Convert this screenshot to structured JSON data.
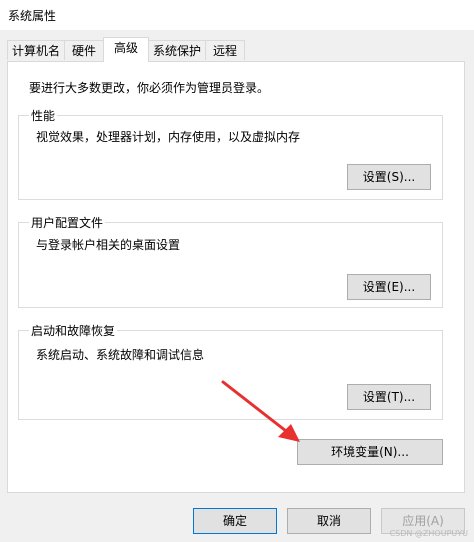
{
  "window": {
    "title": "系统属性"
  },
  "tabs": [
    {
      "label": "计算机名"
    },
    {
      "label": "硬件"
    },
    {
      "label": "高级"
    },
    {
      "label": "系统保护"
    },
    {
      "label": "远程"
    }
  ],
  "notice": "要进行大多数更改，你必须作为管理员登录。",
  "performance": {
    "title": "性能",
    "description": "视觉效果，处理器计划，内存使用，以及虚拟内存",
    "button": "设置(S)..."
  },
  "user_profiles": {
    "title": "用户配置文件",
    "description": "与登录帐户相关的桌面设置",
    "button": "设置(E)..."
  },
  "startup_recovery": {
    "title": "启动和故障恢复",
    "description": "系统启动、系统故障和调试信息",
    "button": "设置(T)..."
  },
  "env_button": "环境变量(N)...",
  "footer": {
    "ok": "确定",
    "cancel": "取消",
    "apply": "应用(A)"
  },
  "annotation": {
    "arrow_color": "#e8302f"
  },
  "watermark": "CSDN @ZHOUPUYU"
}
